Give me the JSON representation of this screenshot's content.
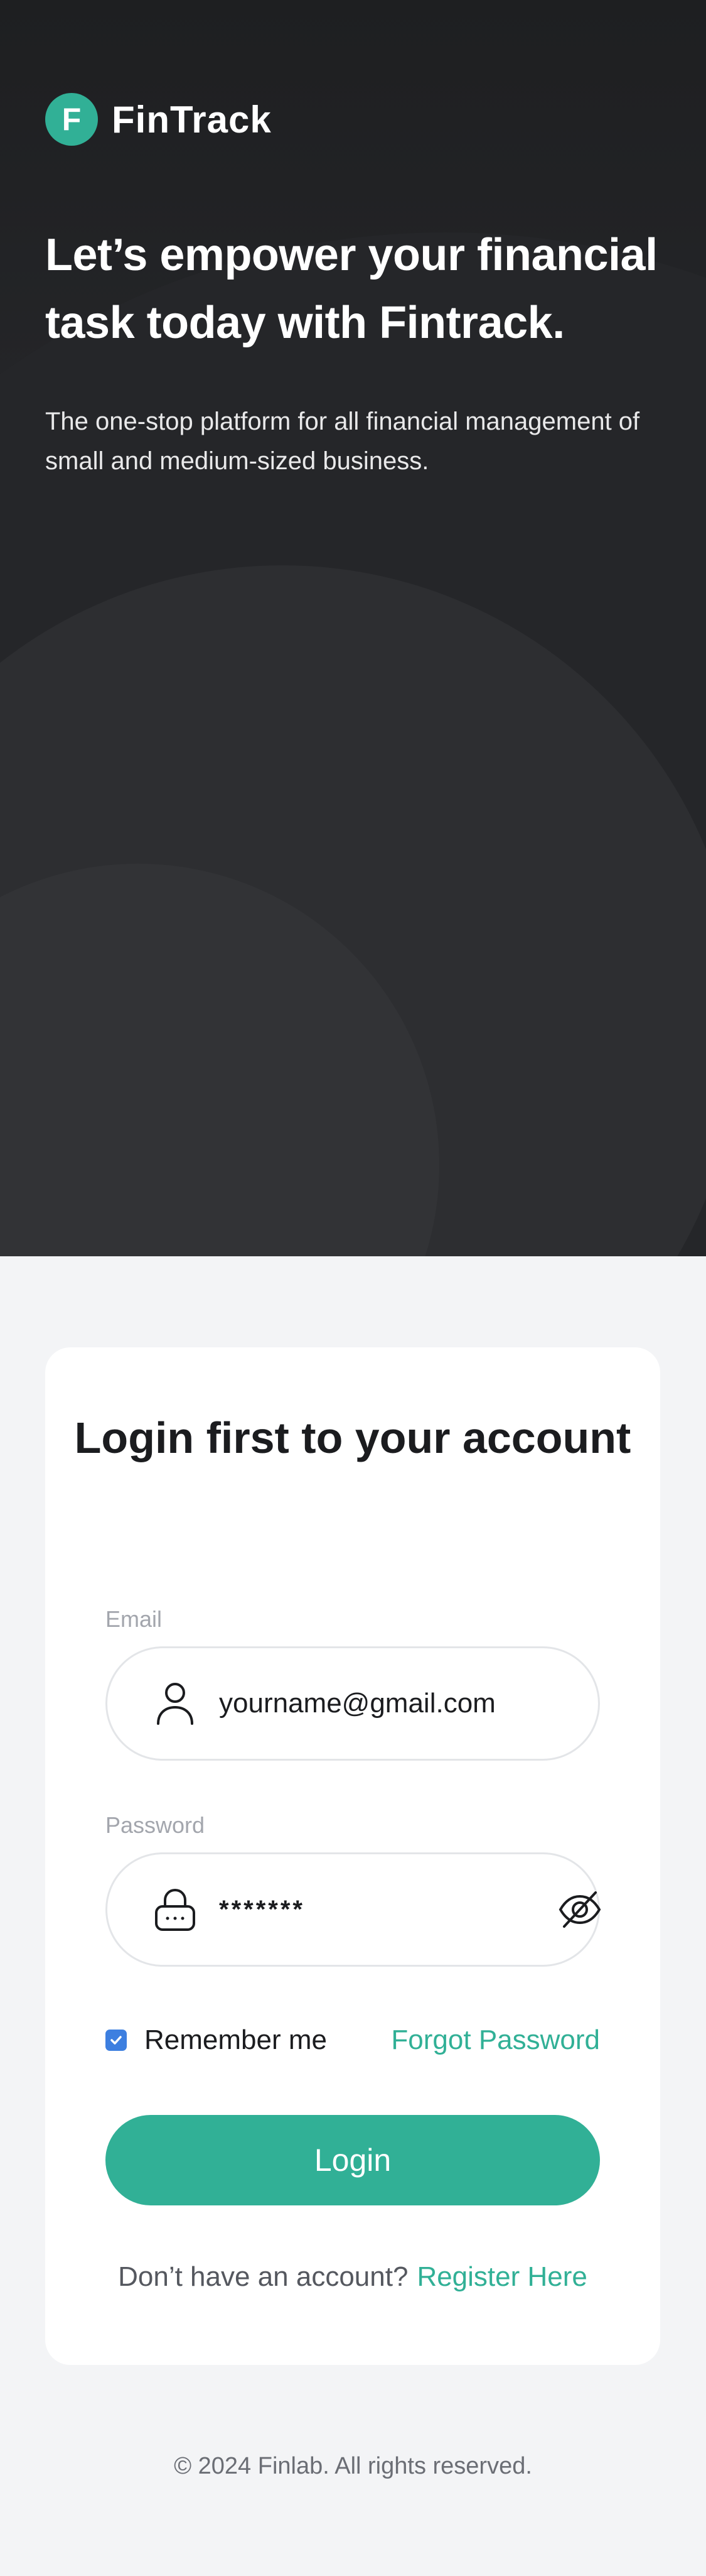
{
  "brand": {
    "logo_letter": "F",
    "name": "FinTrack"
  },
  "hero": {
    "title": "Let’s empower your financial task today with Fintrack.",
    "subtitle": "The one-stop platform for all financial management of small and medium-sized business."
  },
  "login": {
    "title": "Login first to your account",
    "email": {
      "label": "Email",
      "value": "yourname@gmail.com",
      "icon": "user-icon"
    },
    "password": {
      "label": "Password",
      "value": "*******",
      "icon": "lock-icon",
      "toggle_icon": "eye-off-icon"
    },
    "remember_me": {
      "label": "Remember me",
      "checked": true
    },
    "forgot_password": "Forgot Password",
    "submit_label": "Login",
    "register_prompt": "Don’t have an account?",
    "register_link": "Register Here"
  },
  "footer": {
    "copyright": "© 2024 Finlab. All rights reserved."
  },
  "colors": {
    "accent": "#31b096",
    "checkbox": "#3d7fe0",
    "hero_background": "#1e1f21",
    "page_background": "#f3f4f6"
  }
}
